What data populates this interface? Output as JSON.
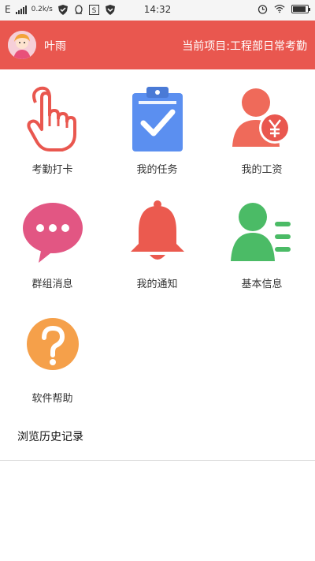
{
  "status_bar": {
    "carrier": "E",
    "speed": "0.2k/s",
    "time": "14:32",
    "battery_level": 0.9
  },
  "header": {
    "username": "叶雨",
    "project_text": "当前项目:工程部日常考勤"
  },
  "menu": [
    {
      "label": "考勤打卡",
      "icon": "hand-tap-icon",
      "color": "#e9574f"
    },
    {
      "label": "我的任务",
      "icon": "clipboard-check-icon",
      "color": "#5b8ff0"
    },
    {
      "label": "我的工资",
      "icon": "salary-user-icon",
      "color": "#ef6a5a"
    },
    {
      "label": "群组消息",
      "icon": "chat-bubble-icon",
      "color": "#e25683"
    },
    {
      "label": "我的通知",
      "icon": "bell-icon",
      "color": "#eb5a4f"
    },
    {
      "label": "基本信息",
      "icon": "profile-card-icon",
      "color": "#4bbb66"
    },
    {
      "label": "软件帮助",
      "icon": "help-icon",
      "color": "#f5a04a"
    }
  ],
  "history_label": "浏览历史记录"
}
